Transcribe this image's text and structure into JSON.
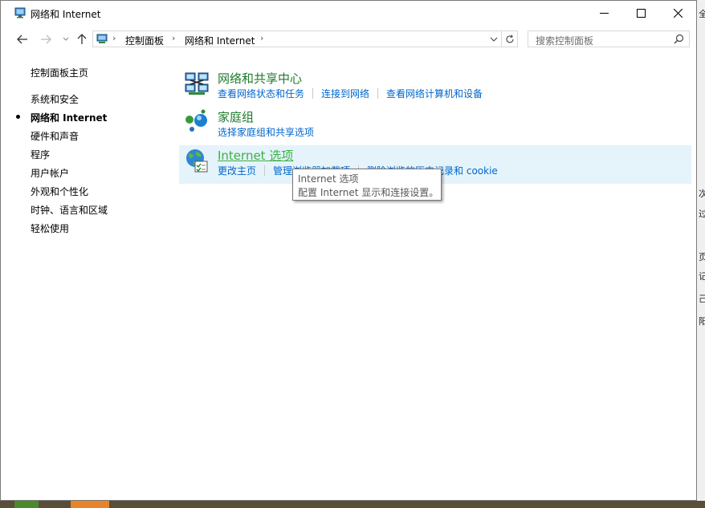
{
  "window": {
    "title": "网络和 Internet",
    "controls": {
      "minimize": "—",
      "maximize": "☐",
      "close": "✕"
    }
  },
  "nav": {
    "breadcrumb": [
      "控制面板",
      "网络和 Internet"
    ]
  },
  "search": {
    "placeholder": "搜索控制面板"
  },
  "sidebar": {
    "items": [
      {
        "label": "控制面板主页",
        "active": false
      },
      {
        "label": "系统和安全",
        "active": false
      },
      {
        "label": "网络和 Internet",
        "active": true
      },
      {
        "label": "硬件和声音",
        "active": false
      },
      {
        "label": "程序",
        "active": false
      },
      {
        "label": "用户帐户",
        "active": false
      },
      {
        "label": "外观和个性化",
        "active": false
      },
      {
        "label": "时钟、语言和区域",
        "active": false
      },
      {
        "label": "轻松使用",
        "active": false
      }
    ]
  },
  "categories": [
    {
      "title": "网络和共享中心",
      "icon": "network-sharing-center-icon",
      "links": [
        "查看网络状态和任务",
        "连接到网络",
        "查看网络计算机和设备"
      ]
    },
    {
      "title": "家庭组",
      "icon": "homegroup-icon",
      "links": [
        "选择家庭组和共享选项"
      ]
    },
    {
      "title": "Internet 选项",
      "icon": "internet-options-icon",
      "links": [
        "更改主页",
        "管理浏览器加载项",
        "删除浏览的历史记录和 cookie"
      ]
    }
  ],
  "tooltip": {
    "title": "Internet 选项",
    "description": "配置 Internet 显示和连接设置。"
  },
  "background": {
    "chars": [
      "全",
      "次",
      "过",
      "页",
      "记",
      "己",
      "阳"
    ]
  },
  "colors": {
    "link": "#0066cc",
    "category_title": "#1e7b2c",
    "hover_bg": "#e5f3fb"
  }
}
